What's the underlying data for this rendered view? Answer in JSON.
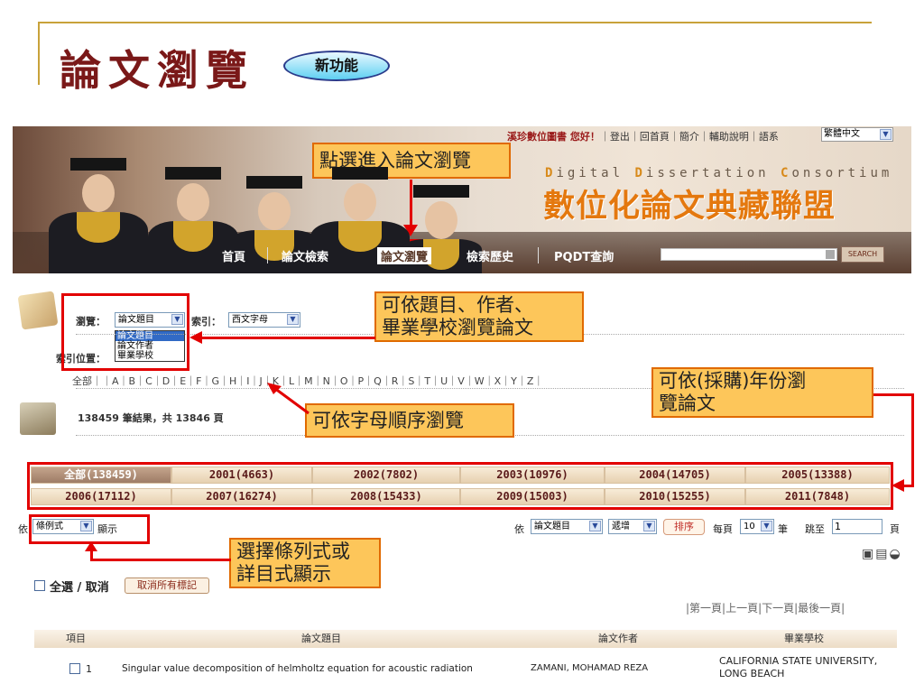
{
  "slide": {
    "title": "論文瀏覽",
    "badge": "新功能"
  },
  "banner": {
    "welcome": "溪珍數位圖書 您好！",
    "links": "｜登出｜回首頁｜簡介｜輔助說明｜語系",
    "language": "繁體中文",
    "title_en_prefix": "D",
    "title_en_1": "igital ",
    "title_en_prefix2": "D",
    "title_en_2": "issertation ",
    "title_en_prefix3": "C",
    "title_en_3": "onsortium",
    "title_zh": "數位化論文典藏聯盟",
    "nav": {
      "home": "首頁",
      "search": "論文檢索",
      "browse": "論文瀏覽",
      "history": "檢索歷史",
      "pqdt": "PQDT查詢"
    },
    "search_button": "SEARCH"
  },
  "browse": {
    "browse_label": "瀏覽：",
    "browse_value": "論文題目",
    "browse_options": [
      "論文題目",
      "論文作者",
      "畢業學校"
    ],
    "index_label": "索引：",
    "index_value": "西文字母",
    "position_label": "索引位置：",
    "alphabet": "全部｜｜A｜B｜C｜D｜E｜F｜G｜H｜I｜J｜K｜L｜M｜N｜O｜P｜Q｜R｜S｜T｜U｜V｜W｜X｜Y｜Z｜",
    "result_summary": "138459 筆結果，共 13846 頁"
  },
  "year_tabs": [
    [
      "全部(138459)",
      "2001(4663)",
      "2002(7802)",
      "2003(10976)",
      "2004(14705)",
      "2005(13388)"
    ],
    [
      "2006(17112)",
      "2007(16274)",
      "2008(15433)",
      "2009(15003)",
      "2010(15255)",
      "2011(7848)"
    ]
  ],
  "controls": {
    "by_prefix": "依",
    "display_value": "條例式",
    "display_suffix": "顯示",
    "sort_field": "論文題目",
    "sort_order": "遞增",
    "sort_button": "排序",
    "per_page_label": "每頁",
    "per_page_value": "10",
    "per_page_unit": "筆",
    "jump_label": "跳至",
    "jump_value": "1",
    "page_unit": "頁",
    "select_all": "全選 / 取消",
    "clear_marks": "取消所有標記",
    "pager": "|第一頁|上一頁|下一頁|最後一頁|"
  },
  "table": {
    "headers": [
      "項目",
      "論文題目",
      "論文作者",
      "畢業學校"
    ],
    "rows": [
      {
        "index": "1",
        "title": "Singular value decomposition of helmholtz equation for acoustic radiation",
        "author": "ZAMANI, MOHAMAD REZA",
        "school": "CALIFORNIA STATE UNIVERSITY, LONG BEACH"
      }
    ]
  },
  "annotations": {
    "enter_browse": "點選進入論文瀏覽",
    "browse_by": "可依題目、作者、\n畢業學校瀏覽論文",
    "by_year": "可依(採購)年份瀏\n覽論文",
    "by_letter": "可依字母順序瀏覽",
    "display_mode": "選擇條列式或\n詳目式顯示"
  },
  "colors": {
    "title": "#7a1818",
    "accent_orange": "#e4780e",
    "annotation_fill": "#fdc65a",
    "annotation_border": "#e06a00",
    "highlight_red": "#e20000"
  }
}
